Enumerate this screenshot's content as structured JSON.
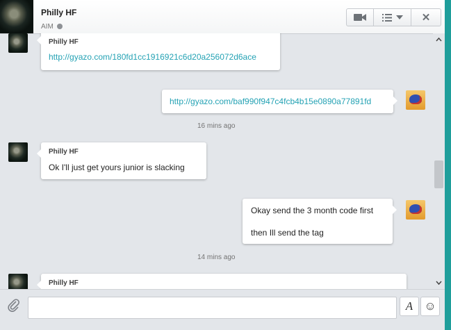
{
  "header": {
    "contact_name": "Philly HF",
    "service": "AIM",
    "buttons": {
      "video": "video-camera-icon",
      "menu": "list-menu-icon",
      "close": "✕"
    }
  },
  "messages": {
    "m1": {
      "sender": "Philly HF",
      "text": "http://gyazo.com/180fd1cc1916921c6d20a256072d6ace"
    },
    "m2": {
      "text": "http://gyazo.com/baf990f947c4fcb4b15e0890a77891fd"
    },
    "t1": "16 mins ago",
    "m3": {
      "sender": "Philly HF",
      "text": "Ok I'll just get yours junior is slacking"
    },
    "m4": {
      "line1": "Okay send the 3 month code first",
      "line2": "then Ill send the tag"
    },
    "t2": "14 mins ago",
    "m5": {
      "sender": "Philly HF"
    }
  },
  "composer": {
    "input_value": "",
    "format_label": "A",
    "emoji_label": "☺"
  },
  "colors": {
    "link": "#24a2b4",
    "background": "#e3e6ea",
    "accent": "#23a3a1"
  }
}
